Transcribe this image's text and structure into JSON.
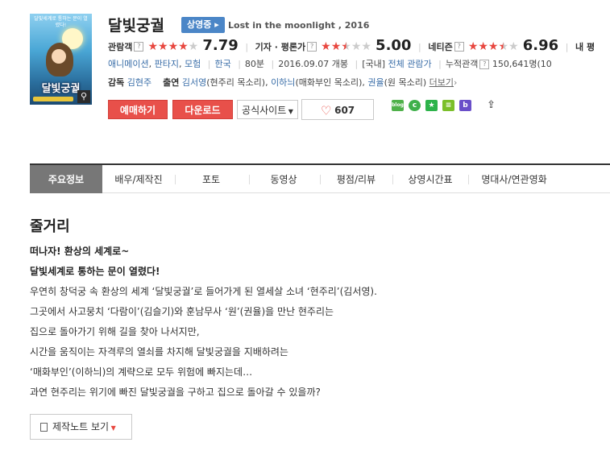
{
  "movie": {
    "poster_title": "달빛궁궐",
    "poster_top_text": "달빛세계로 통하는 문이 열렸다!",
    "title": "달빛궁궐",
    "status_badge": "상영중",
    "original_title": "Lost in the moonlight , 2016"
  },
  "ratings": {
    "audience": {
      "label": "관람객",
      "help": "?",
      "score": "7.79",
      "stars_on": 4
    },
    "critics": {
      "label": "기자 · 평론가",
      "help": "?",
      "score": "5.00",
      "stars_on": 2.5
    },
    "netizen": {
      "label": "네티즌",
      "help": "?",
      "score": "6.96",
      "stars_on": 3.5
    },
    "mine_label": "내 평"
  },
  "info": {
    "genres": [
      "애니메이션",
      "판타지",
      "모험"
    ],
    "country": "한국",
    "runtime": "80분",
    "release": "2016.09.07 개봉",
    "rating_prefix": "[국내]",
    "rating": "전체 관람가",
    "cumulative_label": "누적관객",
    "cumulative_help": "?",
    "cumulative_value": "150,641명",
    "cumulative_tail": "(10"
  },
  "people": {
    "director_label": "감독",
    "director": "김현주",
    "cast_label": "출연",
    "cast": [
      {
        "name": "김서영",
        "role": "(현주리 목소리)"
      },
      {
        "name": "이하늬",
        "role": "(매화부인 목소리)"
      },
      {
        "name": "권율",
        "role": "(원 목소리)"
      }
    ],
    "more": "더보기"
  },
  "actions": {
    "reserve": "예매하기",
    "download": "다운로드",
    "official_site": "공식사이트",
    "likes": "607"
  },
  "share": {
    "blog": "blog",
    "cafe": "c",
    "star": "★",
    "list": "≡",
    "band": "b",
    "share": "⇪"
  },
  "tabs": [
    "주요정보",
    "배우/제작진",
    "포토",
    "동영상",
    "평점/리뷰",
    "상영시간표",
    "명대사/연관영화"
  ],
  "synopsis": {
    "heading": "줄거리",
    "tagline1": "떠나자! 환상의 세계로~",
    "tagline2": "달빛세계로 통하는 문이 열렸다!",
    "lines": [
      "우연히 창덕궁 속 환상의 세계 ‘달빛궁궐’로 들어가게 된 열세살 소녀 ‘현주리’(김서영).",
      " 그곳에서 사고뭉치 ‘다람이’(김슬기)와 훈남무사 ‘원’(권율)을 만난 현주리는",
      " 집으로 돌아가기 위해 길을 찾아 나서지만,",
      " 시간을 움직이는 자격루의 열쇠를 차지해 달빛궁궐을 지배하려는",
      " ‘매화부인’(이하늬)의 계략으로 모두 위험에 빠지는데…",
      " 과연 현주리는 위기에 빠진 달빛궁궐을 구하고 집으로 돌아갈 수 있을까?"
    ],
    "note_button": "제작노트 보기"
  },
  "colors": {
    "accent_red": "#e8504a",
    "badge_blue": "#4b86c7",
    "link_blue": "#3a6ea8",
    "star_red": "#e8473f"
  }
}
